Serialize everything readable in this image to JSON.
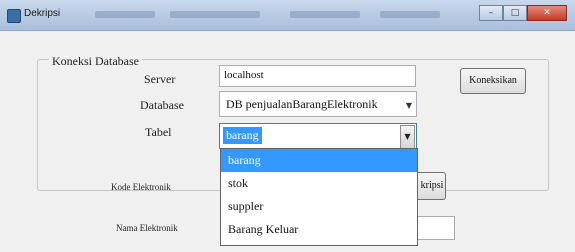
{
  "window": {
    "title": "Dekripsi",
    "controls": [
      "minimize",
      "maximize",
      "close"
    ]
  },
  "koneksi": {
    "legend": "Koneksi Database",
    "server_label": "Server",
    "server_value": "localhost",
    "database_label": "Database",
    "database_value": "DB penjualanBarangElektronik",
    "tabel_label": "Tabel",
    "tabel_value": "barang",
    "connect_button": "Koneksikan"
  },
  "tabel_options": [
    "barang",
    "stok",
    "suppler",
    "Barang Keluar"
  ],
  "form": {
    "kode_label": "Kode Elektronik",
    "nama_label": "Nama Elektronik",
    "dekripsi_button": "kripsi"
  }
}
